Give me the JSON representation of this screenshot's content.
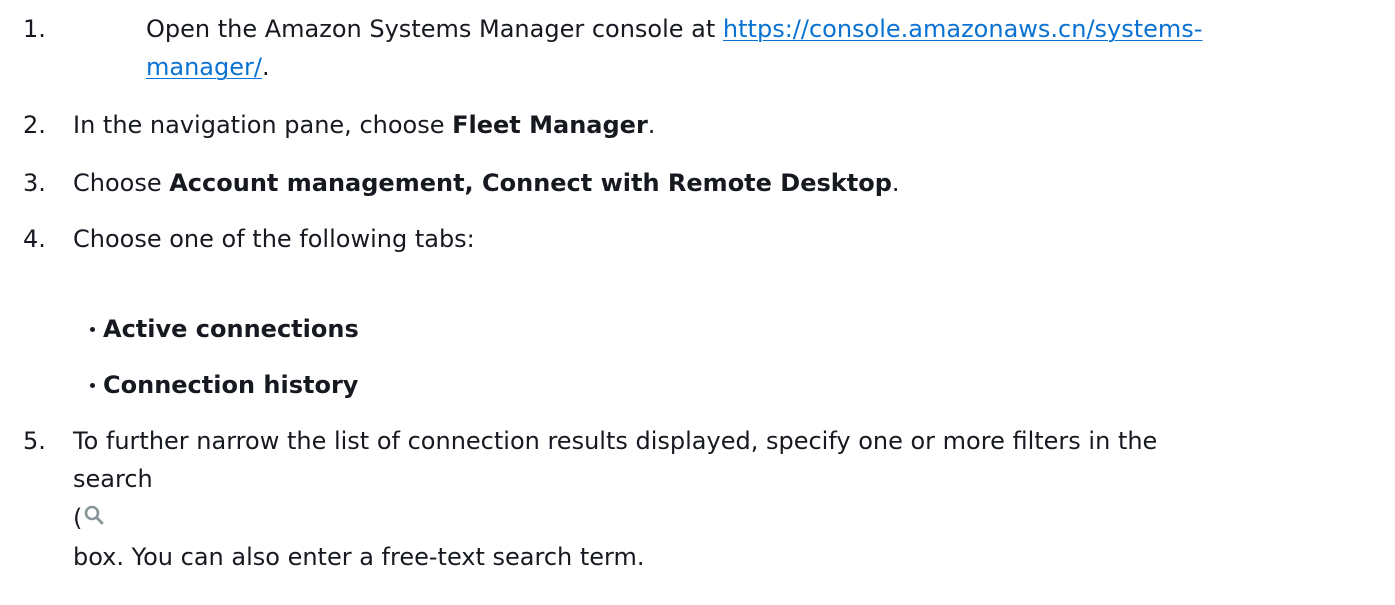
{
  "steps": [
    {
      "number": "1.",
      "text_before": "Open the Amazon Systems Manager console at ",
      "link_part1": "https://console.amazonaws.cn/systems-",
      "link_part2": "manager/",
      "text_after": "."
    },
    {
      "number": "2.",
      "text_before": "In the navigation pane, choose ",
      "bold": "Fleet Manager",
      "text_after": "."
    },
    {
      "number": "3.",
      "text_before": "Choose ",
      "bold": "Account management, Connect with Remote Desktop",
      "text_after": "."
    },
    {
      "number": "4.",
      "text": "Choose one of the following tabs:",
      "tabs": [
        "Active connections",
        "Connection history"
      ]
    },
    {
      "number": "5.",
      "line1": "To further narrow the list of connection results displayed, specify one or more filters in the",
      "line2": "search",
      "line3_prefix": "(",
      "line4": "box. You can also enter a free-text search term."
    }
  ],
  "icons": {
    "search": "search-icon"
  },
  "colors": {
    "link": "#0972d3",
    "text": "#16191f",
    "icon": "#879596"
  }
}
